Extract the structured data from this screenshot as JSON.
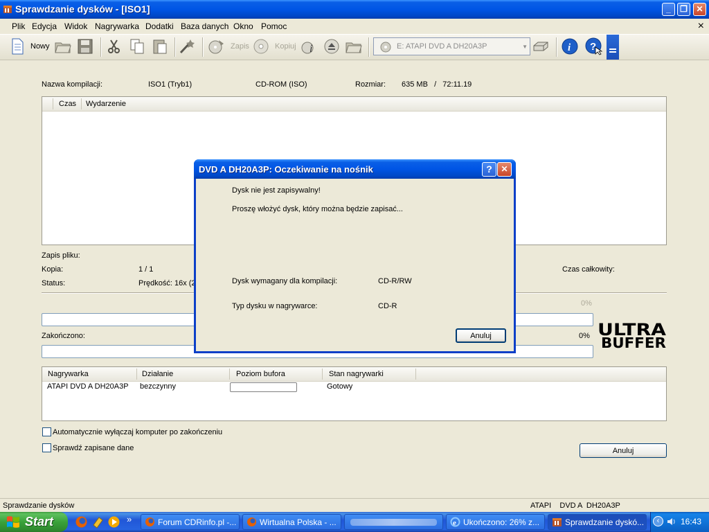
{
  "window": {
    "title": "Sprawdzanie dysków - [ISO1]",
    "buttons": {
      "minimize": "_",
      "restore": "❐",
      "close": "✕"
    }
  },
  "menu": {
    "items": [
      "Plik",
      "Edycja",
      "Widok",
      "Nagrywarka",
      "Dodatki",
      "Baza danych",
      "Okno",
      "Pomoc"
    ],
    "close_glyph": "×"
  },
  "toolbar": {
    "new_label": "Nowy",
    "burn_label": "Zapis",
    "copy_label": "Kopiuj",
    "drive_select_value": "E: ATAPI DVD A  DH20A3P",
    "icons": [
      "new-document-icon",
      "open-folder-icon",
      "save-disk-icon",
      "cut-icon",
      "copy-icon",
      "paste-icon",
      "wizard-icon",
      "burn-icon",
      "copy-disc-icon",
      "info-icon",
      "eject-icon",
      "browse-folder-icon",
      "drive-icon",
      "drive-info-icon",
      "about-icon",
      "help-cursor-icon"
    ]
  },
  "compilation": {
    "name_label": "Nazwa kompilacji:",
    "name_value": "ISO1 (Tryb1)",
    "type_value": "CD-ROM (ISO)",
    "size_label": "Rozmiar:",
    "size_value": "635 MB   /   72:11.19"
  },
  "log": {
    "columns": [
      "Czas",
      "Wydarzenie"
    ]
  },
  "progress": {
    "file_write_label": "Zapis pliku:",
    "copy_label": "Kopia:",
    "copy_value": "1 / 1",
    "status_label": "Status:",
    "speed_value": "Prędkość: 16x (2",
    "total_time_label": "Czas całkowity:",
    "file_percent": "0%",
    "finished_label": "Zakończono:",
    "finished_percent": "0%",
    "file_fraction": 0,
    "finished_fraction": 0
  },
  "recorders": {
    "columns": [
      "Nagrywarka",
      "Działanie",
      "Poziom bufora",
      "Stan nagrywarki"
    ],
    "rows": [
      {
        "recorder": "ATAPI DVD A  DH20A3P",
        "action": "bezczynny",
        "buffer_fraction": 0,
        "state": "Gotowy"
      }
    ]
  },
  "options": {
    "auto_shutdown_label": "Automatycznie wyłączaj komputer po zakończeniu",
    "auto_shutdown_checked": false,
    "verify_label": "Sprawdź zapisane dane",
    "verify_checked": false
  },
  "cancel_button_label": "Anuluj",
  "status_bar": {
    "left": "Sprawdzanie dysków",
    "right": "ATAPI    DVD A  DH20A3P"
  },
  "logo_text": "ULTRA BUFFER",
  "dialog": {
    "title": "DVD A  DH20A3P: Oczekiwanie na nośnik",
    "help_glyph": "?",
    "close_glyph": "✕",
    "message1": "Dysk nie jest zapisywalny!",
    "message2": "Proszę włożyć dysk, który można będzie zapisać...",
    "required_label": "Dysk wymagany dla kompilacji:",
    "required_value": "CD-R/RW",
    "drive_type_label": "Typ dysku w nagrywarce:",
    "drive_type_value": "CD-R",
    "cancel_label": "Anuluj"
  },
  "taskbar": {
    "start_label": "Start",
    "quicklaunch_more": "»",
    "tasks": [
      {
        "label": "Forum CDRinfo.pl -...",
        "active": false
      },
      {
        "label": "Wirtualna Polska - ...",
        "active": false
      },
      {
        "label": "",
        "active": false
      },
      {
        "label": "Ukończono: 26% z...",
        "active": false
      },
      {
        "label": "Sprawdzanie dyskó...",
        "active": true
      }
    ],
    "tray_arrow": "‹",
    "clock": "16:43"
  }
}
